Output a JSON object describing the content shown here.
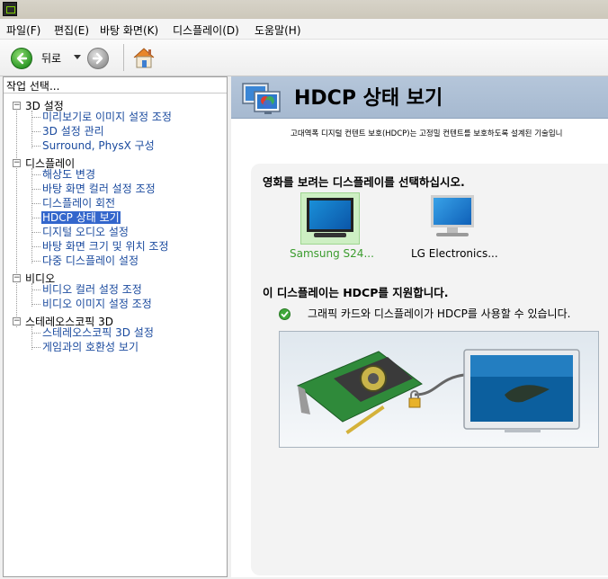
{
  "menu": {
    "items": [
      "파일(F)",
      "편집(E)",
      "바탕 화면(K)",
      "디스플레이(D)",
      "도움말(H)"
    ]
  },
  "toolbar": {
    "back_label": "뒤로",
    "back_icon": "back-arrow-icon",
    "forward_icon": "forward-arrow-icon",
    "home_icon": "home-icon"
  },
  "sidebar": {
    "header": "작업 선택...",
    "categories": [
      {
        "label": "3D 설정",
        "items": [
          "미리보기로 이미지 설정 조정",
          "3D 설정 관리",
          "Surround, PhysX 구성"
        ]
      },
      {
        "label": "디스플레이",
        "items": [
          "해상도 변경",
          "바탕 화면 컬러 설정 조정",
          "디스플레이 회전",
          "HDCP 상태 보기",
          "디지털 오디오 설정",
          "바탕 화면 크기 및 위치 조정",
          "다중 디스플레이 설정"
        ]
      },
      {
        "label": "비디오",
        "items": [
          "비디오 컬러 설정 조정",
          "비디오 이미지 설정 조정"
        ]
      },
      {
        "label": "스테레오스코픽 3D",
        "items": [
          "스테레오스코픽 3D 설정",
          "게임과의 호환성 보기"
        ]
      }
    ],
    "selected": "HDCP 상태 보기"
  },
  "page": {
    "title": "HDCP 상태 보기",
    "description": "고대역폭 디지털 컨텐트 보호(HDCP)는 고정밀 컨텐트를 보호하도록 설계된 기술입니",
    "select_prompt": "영화를 보려는 디스플레이를 선택하십시오.",
    "displays": [
      {
        "label": "Samsung S24...",
        "selected": true
      },
      {
        "label": "LG Electronics...",
        "selected": false
      }
    ],
    "support_heading": "이 디스플레이는 HDCP를 지원합니다.",
    "support_detail": "그래픽 카드와 디스플레이가 HDCP를 사용할 수 있습니다.",
    "status_icon": "check-icon"
  },
  "colors": {
    "selection": "#3366cc",
    "link": "#1a4a9e",
    "selected_display_text": "#3b9c2e",
    "header_band": "#a6b9d0"
  }
}
